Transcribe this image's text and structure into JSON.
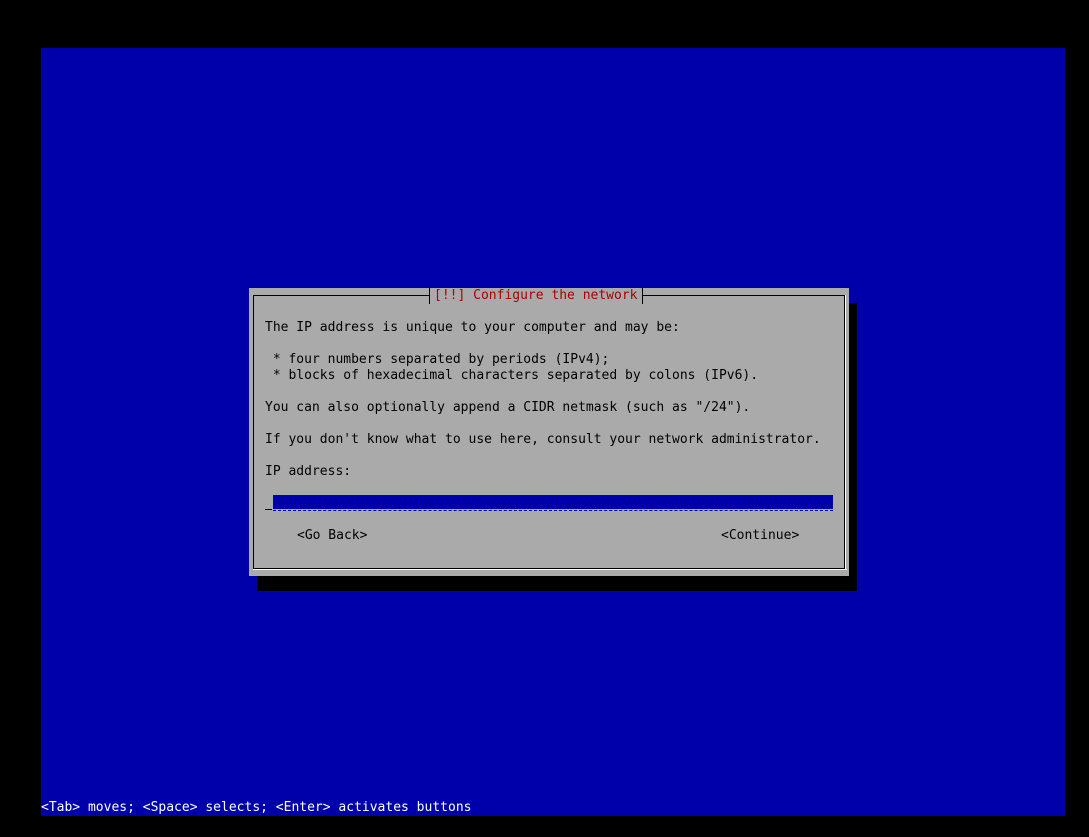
{
  "dialog": {
    "title": "[!!] Configure the network",
    "intro": "The IP address is unique to your computer and may be:",
    "bullets": [
      " * four numbers separated by periods (IPv4);",
      " * blocks of hexadecimal characters separated by colons (IPv6)."
    ],
    "cidr_note": "You can also optionally append a CIDR netmask (such as \"/24\").",
    "help_note": "If you don't know what to use here, consult your network administrator.",
    "field_label": "IP address:",
    "field_value": "",
    "buttons": {
      "back": "<Go Back>",
      "continue": "<Continue>"
    }
  },
  "status_bar": "<Tab> moves; <Space> selects; <Enter> activates buttons",
  "colors": {
    "background": "#0000aa",
    "dialog": "#aaaaaa",
    "title": "#aa0000",
    "status_text": "#ffffff"
  }
}
